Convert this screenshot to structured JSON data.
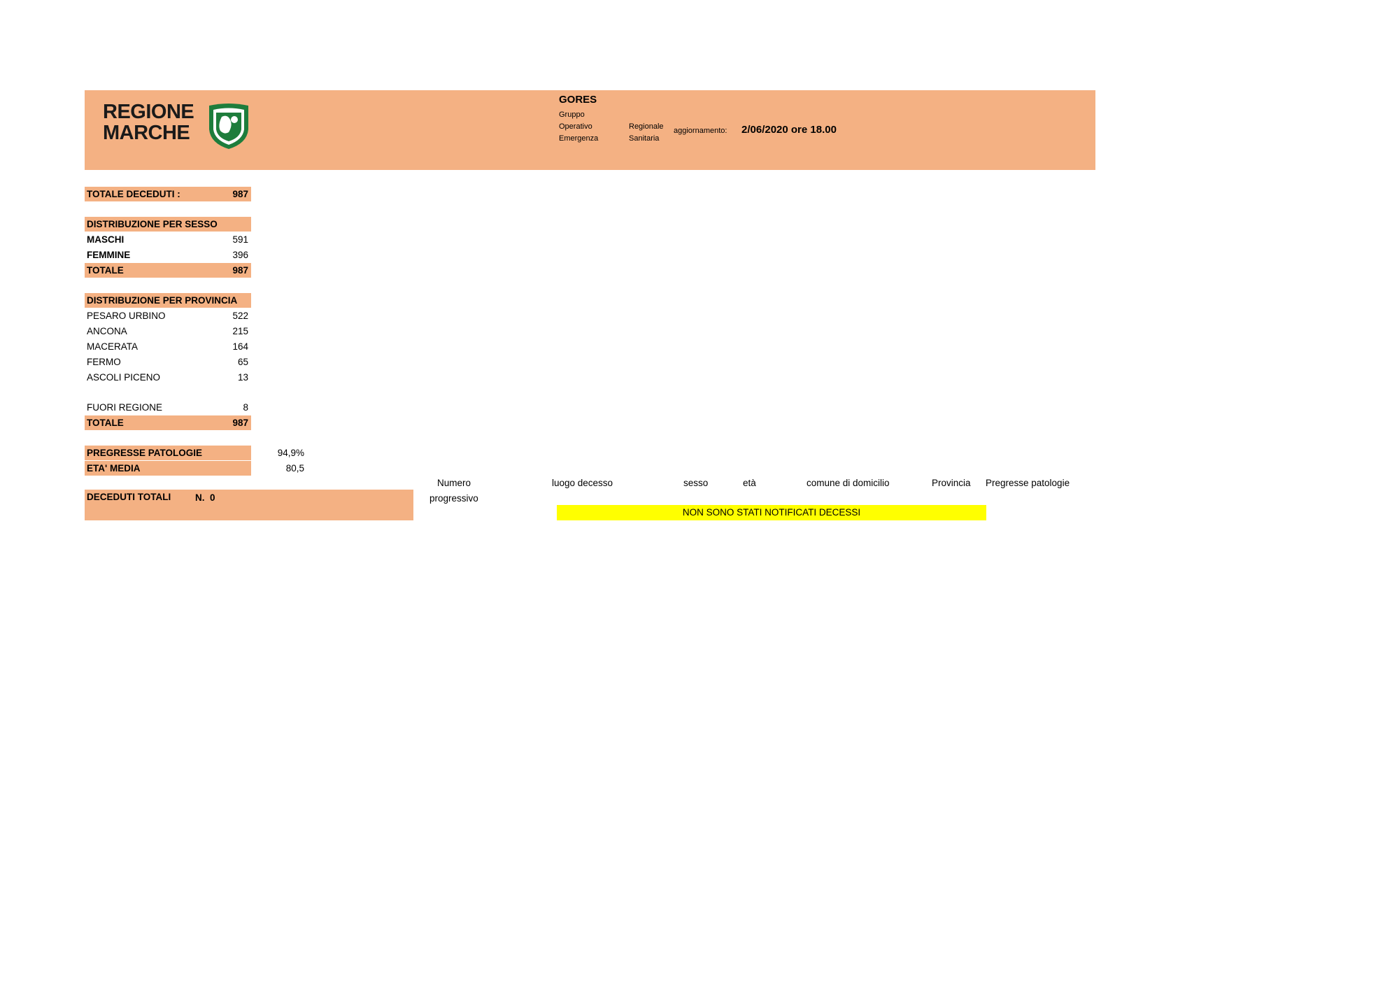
{
  "header": {
    "logo_text": "REGIONE\nMARCHE",
    "org_acronym": "GORES",
    "org_words": [
      "Gruppo",
      "Operativo",
      "Regionale",
      "Emergenza",
      "Sanitaria"
    ],
    "update_label": "aggiornamento:",
    "update_value": "2/06/2020 ore 18.00"
  },
  "totale_deceduti": {
    "label": "TOTALE DECEDUTI :",
    "value": "987"
  },
  "sesso": {
    "title": "DISTRIBUZIONE PER SESSO",
    "rows": [
      {
        "label": "MASCHI",
        "value": "591"
      },
      {
        "label": "FEMMINE",
        "value": "396"
      }
    ],
    "total": {
      "label": "TOTALE",
      "value": "987"
    }
  },
  "provincia": {
    "title": "DISTRIBUZIONE PER PROVINCIA",
    "rows": [
      {
        "label": "PESARO URBINO",
        "value": "522"
      },
      {
        "label": "ANCONA",
        "value": "215"
      },
      {
        "label": "MACERATA",
        "value": "164"
      },
      {
        "label": "FERMO",
        "value": "65"
      },
      {
        "label": "ASCOLI PICENO",
        "value": "13"
      }
    ],
    "fuori": {
      "label": "FUORI REGIONE",
      "value": "8"
    },
    "total": {
      "label": "TOTALE",
      "value": "987"
    }
  },
  "stats": {
    "pregresse": {
      "label": "PREGRESSE PATOLOGIE",
      "value": "94,9%"
    },
    "eta": {
      "label": "ETA' MEDIA",
      "value": "80,5"
    }
  },
  "deceduti_totali": {
    "label": "DECEDUTI TOTALI",
    "n": "N.  0"
  },
  "table": {
    "headers": {
      "numero": "Numero",
      "progressivo": "progressivo",
      "luogo": "luogo decesso",
      "sesso": "sesso",
      "eta": "età",
      "comune": "comune di domicilio",
      "provincia": "Provincia",
      "patologie": "Pregresse patologie"
    },
    "notice": "NON SONO STATI NOTIFICATI DECESSI"
  },
  "colors": {
    "header_bg": "#f4b183",
    "notice_bg": "#ffff00",
    "logo_green": "#1e7d3c"
  }
}
